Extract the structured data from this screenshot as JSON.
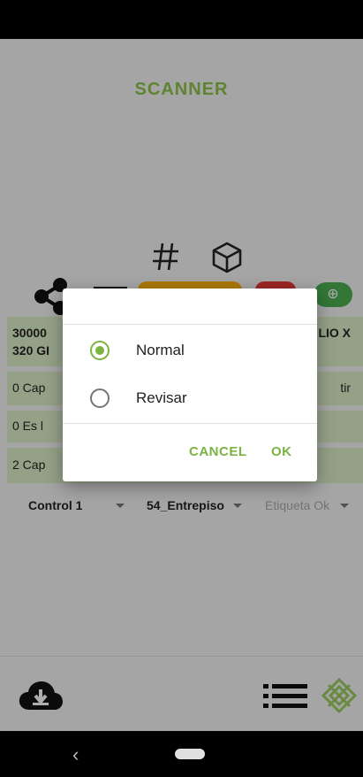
{
  "app": {
    "title": "SCANNER"
  },
  "colors": {
    "accent": "#8bc34a",
    "yellow_button": "#ffb300",
    "red_button": "#e53935",
    "green_button": "#4caf50",
    "row_bg": "#dcedc8"
  },
  "toolbar": {
    "icons": [
      "hash-icon",
      "cube-icon",
      "share-icon",
      "minus-icon",
      "add-circle-icon"
    ],
    "add_symbol": "⊕"
  },
  "rows": [
    {
      "left": "30000",
      "left2": "320 GI",
      "right": "LIO X"
    },
    {
      "left": "0 Cap",
      "right": "tir"
    },
    {
      "left": "0 Es l"
    },
    {
      "left": "2 Cap"
    }
  ],
  "dropdowns": {
    "control": "Control 1",
    "location": "54_Entrepiso",
    "label": "Etiqueta Ok"
  },
  "dialog": {
    "options": [
      {
        "label": "Normal",
        "checked": true
      },
      {
        "label": "Revisar",
        "checked": false
      }
    ],
    "cancel": "CANCEL",
    "ok": "OK"
  },
  "nav": {
    "back": "‹"
  }
}
